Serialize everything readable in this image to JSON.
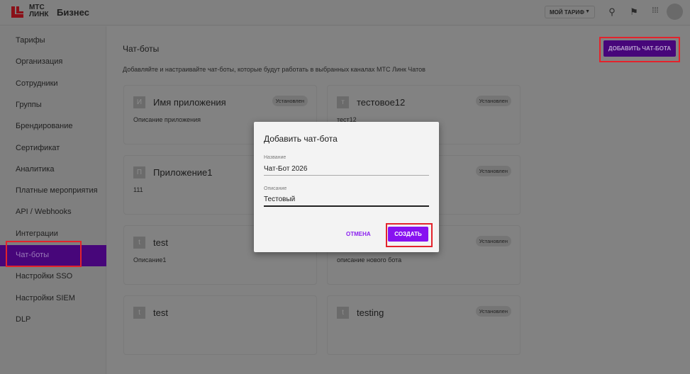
{
  "header": {
    "logo_text_line1": "МТС",
    "logo_text_line2": "ЛИНК",
    "brand": "Бизнес",
    "tariff_label": "МОЙ ТАРИФ"
  },
  "sidebar": {
    "items": [
      {
        "label": "Тарифы"
      },
      {
        "label": "Организация"
      },
      {
        "label": "Сотрудники"
      },
      {
        "label": "Группы"
      },
      {
        "label": "Брендирование"
      },
      {
        "label": "Сертификат"
      },
      {
        "label": "Аналитика"
      },
      {
        "label": "Платные мероприятия"
      },
      {
        "label": "API / Webhooks"
      },
      {
        "label": "Интеграции"
      },
      {
        "label": "Чат-боты",
        "active": true
      },
      {
        "label": "Настройки SSO"
      },
      {
        "label": "Настройки SIEM"
      },
      {
        "label": "DLP"
      }
    ]
  },
  "main": {
    "title": "Чат-боты",
    "subtitle": "Добавляйте и настраивайте чат-боты, которые будут работать в выбранных каналах МТС Линк Чатов",
    "add_button": "ДОБАВИТЬ ЧАТ-БОТА",
    "cards": [
      {
        "initial": "И",
        "title": "Имя приложения",
        "description": "Описание приложения",
        "badge": "Установлен"
      },
      {
        "initial": "т",
        "title": "тестовое12",
        "description": "тест12",
        "badge": "Установлен"
      },
      {
        "initial": "П",
        "title": "Приложение1",
        "description": "111",
        "badge": ""
      },
      {
        "initial": "",
        "title": "",
        "description": "",
        "badge": "Установлен"
      },
      {
        "initial": "t",
        "title": "test",
        "description": "Описание1",
        "badge": ""
      },
      {
        "initial": "",
        "title": "",
        "description": "описание нового бота",
        "badge": "Установлен"
      },
      {
        "initial": "t",
        "title": "test",
        "description": "",
        "badge": ""
      },
      {
        "initial": "t",
        "title": "testing",
        "description": "",
        "badge": "Установлен"
      }
    ]
  },
  "dialog": {
    "title": "Добавить чат-бота",
    "name_label": "Название",
    "name_value": "Чат-Бот 2026",
    "desc_label": "Описание",
    "desc_value": "Тестовый",
    "cancel": "ОТМЕНА",
    "create": "СОЗДАТЬ"
  },
  "colors": {
    "accent": "#8712f0",
    "active": "#47067a",
    "highlight": "#e3232c"
  }
}
